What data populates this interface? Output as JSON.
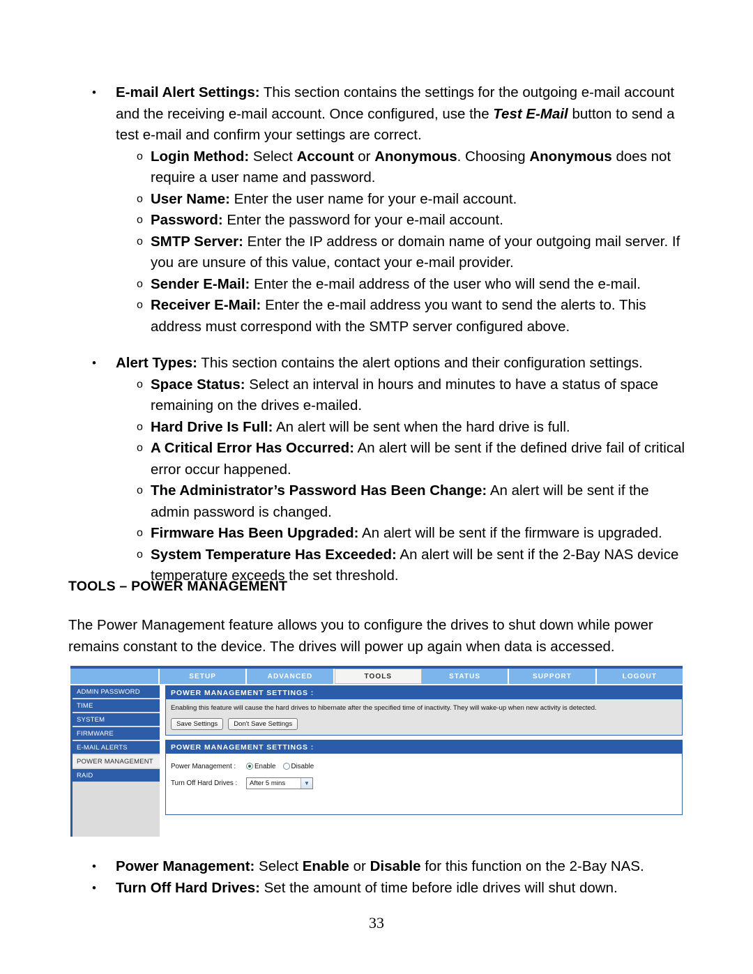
{
  "document": {
    "page_number": "33",
    "section_heading": "TOOLS – POWER MANAGEMENT",
    "intro_paragraph": "The Power Management feature allows you to configure the drives to shut down while power remains constant to the device. The drives will power up again when data is accessed."
  },
  "bullets": {
    "email_alert_settings": {
      "term": "E-mail Alert Settings:",
      "text_before_italic": " This section contains the settings for the outgoing e-mail account and the receiving e-mail account. Once configured, use the ",
      "italic_term": "Test E-Mail",
      "text_after_italic": " button to send a test e-mail and confirm your settings are correct.",
      "sub_items": [
        {
          "term": "Login Method:",
          "text_1": " Select ",
          "bold_1": "Account",
          "text_2": " or ",
          "bold_2": "Anonymous",
          "text_3": ". Choosing ",
          "bold_3": "Anonymous",
          "text_4": " does not require a user name and password."
        },
        {
          "term": "User Name:",
          "text": " Enter the user name for your e-mail account."
        },
        {
          "term": "Password:",
          "text": " Enter the password for your e-mail account."
        },
        {
          "term": "SMTP Server:",
          "text": " Enter the IP address or domain name of your outgoing mail server. If you are unsure of this value, contact your e-mail provider."
        },
        {
          "term": "Sender E-Mail:",
          "text": " Enter the e-mail address of the user who will send the e-mail."
        },
        {
          "term": "Receiver E-Mail:",
          "text": " Enter the e-mail address you want to send the alerts to. This address must correspond with the SMTP server configured above."
        }
      ]
    },
    "alert_types": {
      "term": "Alert Types:",
      "text": " This section contains the alert options and their configuration settings.",
      "sub_items": [
        {
          "term": "Space Status:",
          "text": " Select an interval in hours and minutes to have a status of space remaining on the drives e-mailed."
        },
        {
          "term": "Hard Drive Is Full:",
          "text": " An alert will be sent when the hard drive is full."
        },
        {
          "term": "A Critical Error Has Occurred:",
          "text": " An alert will be sent if the defined drive fail of critical error occur happened."
        },
        {
          "term": "The Administrator’s Password Has Been Change:",
          "text": " An alert will be sent if the admin password is changed."
        },
        {
          "term": "Firmware Has Been Upgraded:",
          "text": " An alert will be sent if the firmware is upgraded."
        },
        {
          "term": "System Temperature Has Exceeded:",
          "text": " An alert will be sent if the 2-Bay NAS device temperature exceeds the set threshold."
        }
      ]
    },
    "bottom": [
      {
        "term": "Power Management:",
        "text_1": " Select ",
        "bold_1": "Enable",
        "text_2": " or ",
        "bold_2": "Disable",
        "text_3": " for this function on the 2-Bay NAS."
      },
      {
        "term": "Turn Off Hard Drives:",
        "text_1": " Set the amount of time before idle drives will shut down.",
        "bold_1": "",
        "text_2": "",
        "bold_2": "",
        "text_3": ""
      }
    ],
    "marker_level1": "•",
    "marker_level2": "o"
  },
  "ui": {
    "nav_tabs": [
      {
        "label": "SETUP",
        "active": false
      },
      {
        "label": "ADVANCED",
        "active": false
      },
      {
        "label": "TOOLS",
        "active": true
      },
      {
        "label": "STATUS",
        "active": false
      },
      {
        "label": "SUPPORT",
        "active": false
      },
      {
        "label": "LOGOUT",
        "active": false
      }
    ],
    "sidebar": [
      {
        "label": "ADMIN PASSWORD",
        "active": false
      },
      {
        "label": "TIME",
        "active": false
      },
      {
        "label": "SYSTEM",
        "active": false
      },
      {
        "label": "FIRMWARE",
        "active": false
      },
      {
        "label": "E-MAIL ALERTS",
        "active": false
      },
      {
        "label": "POWER MANAGEMENT",
        "active": true
      },
      {
        "label": "RAID",
        "active": false
      }
    ],
    "panel_top": {
      "header": "POWER MANAGEMENT SETTINGS :",
      "description": "Enabling this feature will cause the hard drives to hibernate after the specified time of inactivity. They will wake-up when new activity is detected.",
      "save_button": "Save Settings",
      "dont_save_button": "Don't Save Settings"
    },
    "panel_bottom": {
      "header": "POWER MANAGEMENT SETTINGS :",
      "power_management_label": "Power Management :",
      "radio_enable": "Enable",
      "radio_disable": "Disable",
      "selected_radio": "Enable",
      "turn_off_label": "Turn Off Hard Drives :",
      "turn_off_value": "After 5 mins",
      "dropdown_arrow": "▼"
    },
    "colors": {
      "nav_blue": "#7cb5eb",
      "panel_blue": "#2a5caa",
      "sidebar_blue": "#2d5ca8",
      "sidebar_bg": "#dcdcdc",
      "panel_body_gray": "#e3e3e3"
    }
  }
}
